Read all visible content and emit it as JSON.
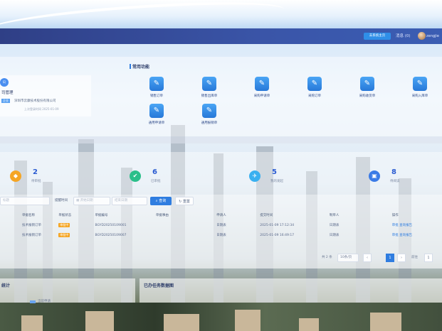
{
  "topbar": {
    "system_button": "去系统主页",
    "message_label": "消息",
    "message_count": "(0)",
    "username": "zengjie"
  },
  "company": {
    "initial": "公",
    "name_fragment": "司管理",
    "tag": "企业",
    "full_name": "深圳市云康技术股份有限公司",
    "meta": "上次登录时间 2025-01-09"
  },
  "quick": {
    "title": "常用功能",
    "items": [
      {
        "label": "销售订单",
        "icon": "form-icon"
      },
      {
        "label": "销售出库单",
        "icon": "form-icon"
      },
      {
        "label": "采购申请单",
        "icon": "form-icon"
      },
      {
        "label": "采购订单",
        "icon": "form-icon"
      },
      {
        "label": "采购收货单",
        "icon": "form-icon"
      },
      {
        "label": "采购入库单",
        "icon": "form-icon"
      },
      {
        "label": "通用申请单",
        "icon": "form-icon"
      },
      {
        "label": "通用报销单",
        "icon": "form-icon"
      }
    ]
  },
  "stats": [
    {
      "value": "2",
      "label": "待审批",
      "color": "#f5a524",
      "glyph": "◆"
    },
    {
      "value": "6",
      "label": "已审批",
      "color": "#2bbf8a",
      "glyph": "✔"
    },
    {
      "value": "5",
      "label": "我的发起",
      "color": "#3ab0f0",
      "glyph": "✈"
    },
    {
      "value": "8",
      "label": "待阅读",
      "color": "#3b7be6",
      "glyph": "▣"
    }
  ],
  "filters": {
    "title_placeholder": "标题",
    "time_label": "提醒时间",
    "start_placeholder": "开始日期",
    "end_placeholder": "结束日期",
    "search_label": "查询",
    "reset_label": "重置"
  },
  "table": {
    "headers": [
      "单据名称",
      "单据状态",
      "单据编号",
      "单据事由",
      "申请人",
      "提交时间",
      "制单人",
      "操作"
    ],
    "rows": [
      {
        "name": "技术报销订单",
        "status": "审批中",
        "no": "BGYD20250109001",
        "reason": "",
        "applicant": "日期表",
        "time": "2025-01-09 17:12:34",
        "maker": "日期表",
        "op1": "审批",
        "op2": "查询报告"
      },
      {
        "name": "技术报销订单",
        "status": "审批中",
        "no": "BGYD20250109007",
        "reason": "",
        "applicant": "日期表",
        "time": "2025-01-09 16:49:17",
        "maker": "日期表",
        "op1": "审批",
        "op2": "查询报告"
      }
    ]
  },
  "pagination": {
    "total": "共 2 条",
    "page_size": "10条/页",
    "current_page": "1",
    "goto_label": "前往",
    "goto_value": "1"
  },
  "bottom": {
    "left_title": "统计",
    "left_legend": "当前申请",
    "right_title": "已办任务数据图"
  }
}
